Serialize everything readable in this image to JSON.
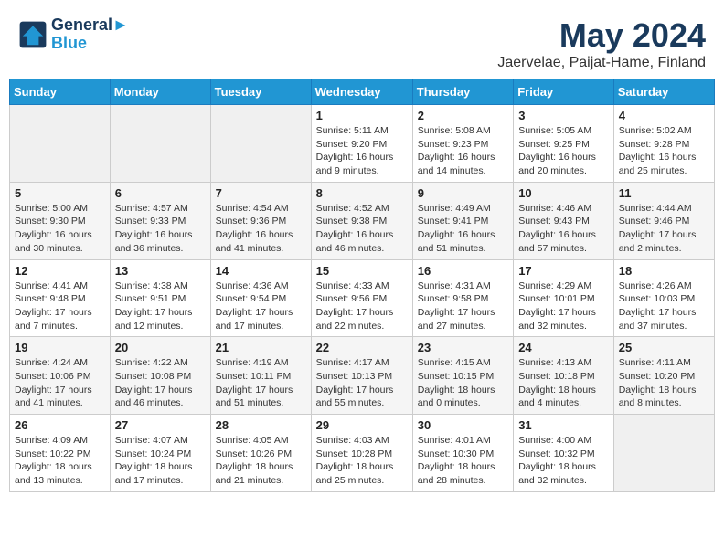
{
  "header": {
    "logo_line1": "General",
    "logo_line2": "Blue",
    "title": "May 2024",
    "subtitle": "Jaervelae, Paijat-Hame, Finland"
  },
  "calendar": {
    "days_of_week": [
      "Sunday",
      "Monday",
      "Tuesday",
      "Wednesday",
      "Thursday",
      "Friday",
      "Saturday"
    ],
    "weeks": [
      [
        {
          "day": "",
          "info": ""
        },
        {
          "day": "",
          "info": ""
        },
        {
          "day": "",
          "info": ""
        },
        {
          "day": "1",
          "info": "Sunrise: 5:11 AM\nSunset: 9:20 PM\nDaylight: 16 hours\nand 9 minutes."
        },
        {
          "day": "2",
          "info": "Sunrise: 5:08 AM\nSunset: 9:23 PM\nDaylight: 16 hours\nand 14 minutes."
        },
        {
          "day": "3",
          "info": "Sunrise: 5:05 AM\nSunset: 9:25 PM\nDaylight: 16 hours\nand 20 minutes."
        },
        {
          "day": "4",
          "info": "Sunrise: 5:02 AM\nSunset: 9:28 PM\nDaylight: 16 hours\nand 25 minutes."
        }
      ],
      [
        {
          "day": "5",
          "info": "Sunrise: 5:00 AM\nSunset: 9:30 PM\nDaylight: 16 hours\nand 30 minutes."
        },
        {
          "day": "6",
          "info": "Sunrise: 4:57 AM\nSunset: 9:33 PM\nDaylight: 16 hours\nand 36 minutes."
        },
        {
          "day": "7",
          "info": "Sunrise: 4:54 AM\nSunset: 9:36 PM\nDaylight: 16 hours\nand 41 minutes."
        },
        {
          "day": "8",
          "info": "Sunrise: 4:52 AM\nSunset: 9:38 PM\nDaylight: 16 hours\nand 46 minutes."
        },
        {
          "day": "9",
          "info": "Sunrise: 4:49 AM\nSunset: 9:41 PM\nDaylight: 16 hours\nand 51 minutes."
        },
        {
          "day": "10",
          "info": "Sunrise: 4:46 AM\nSunset: 9:43 PM\nDaylight: 16 hours\nand 57 minutes."
        },
        {
          "day": "11",
          "info": "Sunrise: 4:44 AM\nSunset: 9:46 PM\nDaylight: 17 hours\nand 2 minutes."
        }
      ],
      [
        {
          "day": "12",
          "info": "Sunrise: 4:41 AM\nSunset: 9:48 PM\nDaylight: 17 hours\nand 7 minutes."
        },
        {
          "day": "13",
          "info": "Sunrise: 4:38 AM\nSunset: 9:51 PM\nDaylight: 17 hours\nand 12 minutes."
        },
        {
          "day": "14",
          "info": "Sunrise: 4:36 AM\nSunset: 9:54 PM\nDaylight: 17 hours\nand 17 minutes."
        },
        {
          "day": "15",
          "info": "Sunrise: 4:33 AM\nSunset: 9:56 PM\nDaylight: 17 hours\nand 22 minutes."
        },
        {
          "day": "16",
          "info": "Sunrise: 4:31 AM\nSunset: 9:58 PM\nDaylight: 17 hours\nand 27 minutes."
        },
        {
          "day": "17",
          "info": "Sunrise: 4:29 AM\nSunset: 10:01 PM\nDaylight: 17 hours\nand 32 minutes."
        },
        {
          "day": "18",
          "info": "Sunrise: 4:26 AM\nSunset: 10:03 PM\nDaylight: 17 hours\nand 37 minutes."
        }
      ],
      [
        {
          "day": "19",
          "info": "Sunrise: 4:24 AM\nSunset: 10:06 PM\nDaylight: 17 hours\nand 41 minutes."
        },
        {
          "day": "20",
          "info": "Sunrise: 4:22 AM\nSunset: 10:08 PM\nDaylight: 17 hours\nand 46 minutes."
        },
        {
          "day": "21",
          "info": "Sunrise: 4:19 AM\nSunset: 10:11 PM\nDaylight: 17 hours\nand 51 minutes."
        },
        {
          "day": "22",
          "info": "Sunrise: 4:17 AM\nSunset: 10:13 PM\nDaylight: 17 hours\nand 55 minutes."
        },
        {
          "day": "23",
          "info": "Sunrise: 4:15 AM\nSunset: 10:15 PM\nDaylight: 18 hours\nand 0 minutes."
        },
        {
          "day": "24",
          "info": "Sunrise: 4:13 AM\nSunset: 10:18 PM\nDaylight: 18 hours\nand 4 minutes."
        },
        {
          "day": "25",
          "info": "Sunrise: 4:11 AM\nSunset: 10:20 PM\nDaylight: 18 hours\nand 8 minutes."
        }
      ],
      [
        {
          "day": "26",
          "info": "Sunrise: 4:09 AM\nSunset: 10:22 PM\nDaylight: 18 hours\nand 13 minutes."
        },
        {
          "day": "27",
          "info": "Sunrise: 4:07 AM\nSunset: 10:24 PM\nDaylight: 18 hours\nand 17 minutes."
        },
        {
          "day": "28",
          "info": "Sunrise: 4:05 AM\nSunset: 10:26 PM\nDaylight: 18 hours\nand 21 minutes."
        },
        {
          "day": "29",
          "info": "Sunrise: 4:03 AM\nSunset: 10:28 PM\nDaylight: 18 hours\nand 25 minutes."
        },
        {
          "day": "30",
          "info": "Sunrise: 4:01 AM\nSunset: 10:30 PM\nDaylight: 18 hours\nand 28 minutes."
        },
        {
          "day": "31",
          "info": "Sunrise: 4:00 AM\nSunset: 10:32 PM\nDaylight: 18 hours\nand 32 minutes."
        },
        {
          "day": "",
          "info": ""
        }
      ]
    ]
  }
}
